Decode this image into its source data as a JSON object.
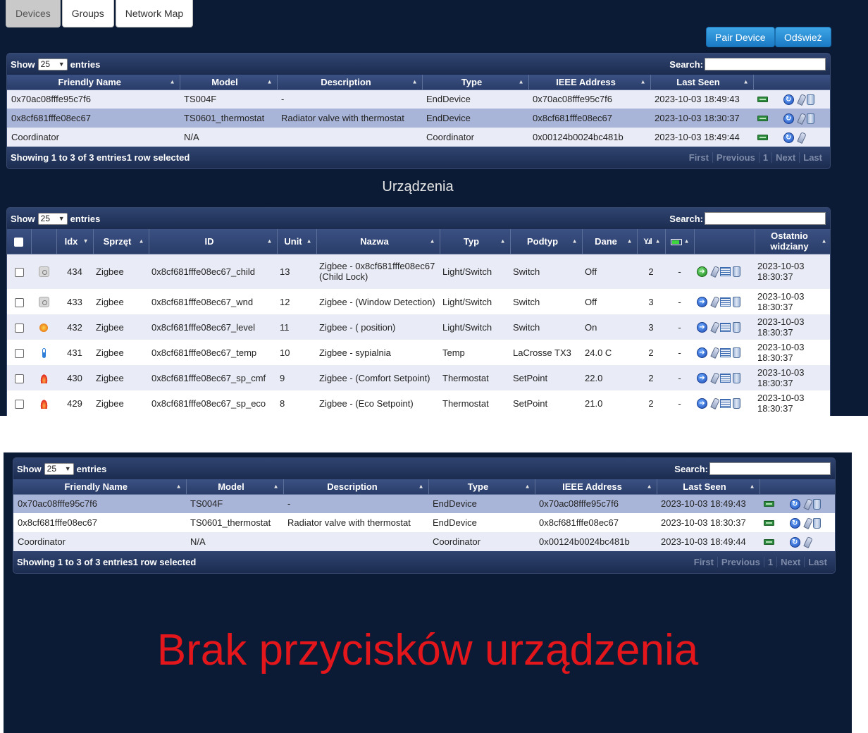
{
  "tabs": [
    {
      "label": "Devices"
    },
    {
      "label": "Groups"
    },
    {
      "label": "Network Map"
    }
  ],
  "actions": {
    "pair_label": "Pair Device",
    "refresh_label": "Odśwież"
  },
  "devices_table": {
    "show_label": "Show",
    "entries_value": "25",
    "entries_label": "entries",
    "search_label": "Search:",
    "columns": [
      "Friendly Name",
      "Model",
      "Description",
      "Type",
      "IEEE Address",
      "Last Seen"
    ],
    "rows": [
      {
        "name": "0x70ac08fffe95c7f6",
        "model": "TS004F",
        "description": "-",
        "type": "EndDevice",
        "ieee": "0x70ac08fffe95c7f6",
        "last_seen": "2023-10-03 18:49:43"
      },
      {
        "name": "0x8cf681fffe08ec67",
        "model": "TS0601_thermostat",
        "description": "Radiator valve with thermostat",
        "type": "EndDevice",
        "ieee": "0x8cf681fffe08ec67",
        "last_seen": "2023-10-03 18:30:37"
      },
      {
        "name": "Coordinator",
        "model": "N/A",
        "description": "",
        "type": "Coordinator",
        "ieee": "0x00124b0024bc481b",
        "last_seen": "2023-10-03 18:49:44"
      }
    ],
    "footer": "Showing 1 to 3 of 3 entries1 row selected",
    "pager": [
      "First",
      "Previous",
      "1",
      "Next",
      "Last"
    ]
  },
  "section_title": "Urządzenia",
  "urz_table": {
    "show_label": "Show",
    "entries_value": "25",
    "entries_label": "entries",
    "search_label": "Search:",
    "columns": {
      "idx": "Idx",
      "hw": "Sprzęt",
      "id": "ID",
      "unit": "Unit",
      "name": "Nazwa",
      "type": "Typ",
      "subtype": "Podtyp",
      "data": "Dane",
      "last_seen": "Ostatnio widziany"
    },
    "rows": [
      {
        "icon": "switch-icon",
        "idx": "434",
        "hw": "Zigbee",
        "id": "0x8cf681fffe08ec67_child",
        "unit": "13",
        "name": "Zigbee - 0x8cf681fffe08ec67 (Child Lock)",
        "type": "Light/Switch",
        "subtype": "Switch",
        "data": "Off",
        "signal": "2",
        "battery": "-",
        "last_seen": "2023-10-03 18:30:37"
      },
      {
        "icon": "switch-icon",
        "idx": "433",
        "hw": "Zigbee",
        "id": "0x8cf681fffe08ec67_wnd",
        "unit": "12",
        "name": "Zigbee - (Window Detection)",
        "type": "Light/Switch",
        "subtype": "Switch",
        "data": "Off",
        "signal": "3",
        "battery": "-",
        "last_seen": "2023-10-03 18:30:37"
      },
      {
        "icon": "lamp-icon",
        "idx": "432",
        "hw": "Zigbee",
        "id": "0x8cf681fffe08ec67_level",
        "unit": "11",
        "name": "Zigbee - ( position)",
        "type": "Light/Switch",
        "subtype": "Switch",
        "data": "On",
        "signal": "3",
        "battery": "-",
        "last_seen": "2023-10-03 18:30:37"
      },
      {
        "icon": "thermometer-icon",
        "idx": "431",
        "hw": "Zigbee",
        "id": "0x8cf681fffe08ec67_temp",
        "unit": "10",
        "name": "Zigbee - sypialnia",
        "type": "Temp",
        "subtype": "LaCrosse TX3",
        "data": "24.0 C",
        "signal": "2",
        "battery": "-",
        "last_seen": "2023-10-03 18:30:37"
      },
      {
        "icon": "flame-icon",
        "idx": "430",
        "hw": "Zigbee",
        "id": "0x8cf681fffe08ec67_sp_cmf",
        "unit": "9",
        "name": "Zigbee - (Comfort Setpoint)",
        "type": "Thermostat",
        "subtype": "SetPoint",
        "data": "22.0",
        "signal": "2",
        "battery": "-",
        "last_seen": "2023-10-03 18:30:37"
      },
      {
        "icon": "flame-icon",
        "idx": "429",
        "hw": "Zigbee",
        "id": "0x8cf681fffe08ec67_sp_eco",
        "unit": "8",
        "name": "Zigbee - (Eco Setpoint)",
        "type": "Thermostat",
        "subtype": "SetPoint",
        "data": "21.0",
        "signal": "2",
        "battery": "-",
        "last_seen": "2023-10-03 18:30:37"
      }
    ]
  },
  "bottom_table": {
    "show_label": "Show",
    "entries_value": "25",
    "entries_label": "entries",
    "search_label": "Search:",
    "columns": [
      "Friendly Name",
      "Model",
      "Description",
      "Type",
      "IEEE Address",
      "Last Seen"
    ],
    "rows": [
      {
        "name": "0x70ac08fffe95c7f6",
        "model": "TS004F",
        "description": "-",
        "type": "EndDevice",
        "ieee": "0x70ac08fffe95c7f6",
        "last_seen": "2023-10-03 18:49:43"
      },
      {
        "name": "0x8cf681fffe08ec67",
        "model": "TS0601_thermostat",
        "description": "Radiator valve with thermostat",
        "type": "EndDevice",
        "ieee": "0x8cf681fffe08ec67",
        "last_seen": "2023-10-03 18:30:37"
      },
      {
        "name": "Coordinator",
        "model": "N/A",
        "description": "",
        "type": "Coordinator",
        "ieee": "0x00124b0024bc481b",
        "last_seen": "2023-10-03 18:49:44"
      }
    ],
    "footer": "Showing 1 to 3 of 3 entries1 row selected",
    "pager": [
      "First",
      "Previous",
      "1",
      "Next",
      "Last"
    ]
  },
  "message": "Brak przycisków urządzenia",
  "colors": {
    "panel_bg": "#0b1a35",
    "header_bg": "#2a3d69",
    "selected_row": "#a9b5d8",
    "message": "#e3161c",
    "button": "#1a7ac4"
  }
}
